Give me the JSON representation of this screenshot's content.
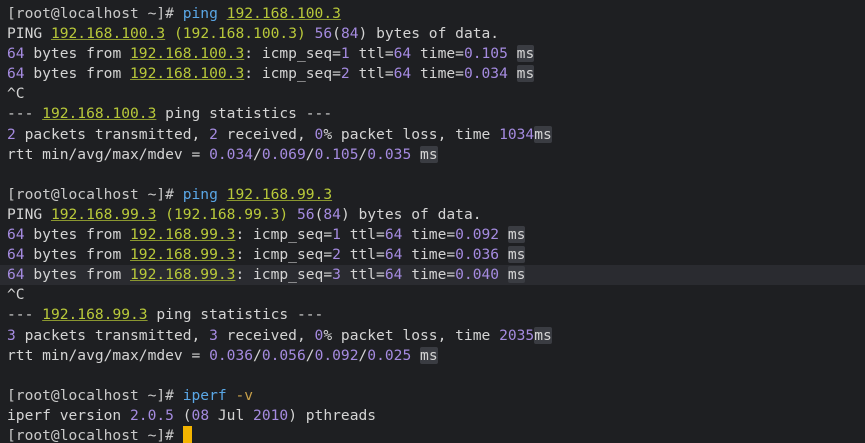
{
  "colors": {
    "background": "#1e1f22",
    "text": "#d4d4d4",
    "command": "#5aa7e6",
    "ip": "#b9c93a",
    "number": "#a58be0",
    "cursor": "#f4b400"
  },
  "lines": [
    {
      "segs": [
        [
          "prompt",
          "[root@localhost ~]# "
        ],
        [
          "cmd",
          "ping "
        ],
        [
          "ip",
          "192.168.100.3"
        ]
      ]
    },
    {
      "segs": [
        [
          "text",
          "PING "
        ],
        [
          "ip",
          "192.168.100.3"
        ],
        [
          "text",
          " "
        ],
        [
          "paren",
          "(192.168.100.3)"
        ],
        [
          "text",
          " "
        ],
        [
          "num",
          "56"
        ],
        [
          "text",
          "("
        ],
        [
          "num",
          "84"
        ],
        [
          "text",
          ") bytes of data."
        ]
      ]
    },
    {
      "segs": [
        [
          "num",
          "64"
        ],
        [
          "text",
          " bytes from "
        ],
        [
          "ip",
          "192.168.100.3"
        ],
        [
          "text",
          ": icmp_seq="
        ],
        [
          "num",
          "1"
        ],
        [
          "text",
          " ttl="
        ],
        [
          "num",
          "64"
        ],
        [
          "text",
          " time="
        ],
        [
          "num",
          "0.105"
        ],
        [
          "text",
          " "
        ],
        [
          "unit",
          "ms"
        ]
      ]
    },
    {
      "segs": [
        [
          "num",
          "64"
        ],
        [
          "text",
          " bytes from "
        ],
        [
          "ip",
          "192.168.100.3"
        ],
        [
          "text",
          ": icmp_seq="
        ],
        [
          "num",
          "2"
        ],
        [
          "text",
          " ttl="
        ],
        [
          "num",
          "64"
        ],
        [
          "text",
          " time="
        ],
        [
          "num",
          "0.034"
        ],
        [
          "text",
          " "
        ],
        [
          "unit",
          "ms"
        ]
      ]
    },
    {
      "segs": [
        [
          "text",
          "^C"
        ]
      ]
    },
    {
      "segs": [
        [
          "text",
          "--- "
        ],
        [
          "ip",
          "192.168.100.3"
        ],
        [
          "text",
          " ping statistics ---"
        ]
      ]
    },
    {
      "segs": [
        [
          "num",
          "2"
        ],
        [
          "text",
          " packets transmitted, "
        ],
        [
          "num",
          "2"
        ],
        [
          "text",
          " received, "
        ],
        [
          "num",
          "0"
        ],
        [
          "text",
          "% packet loss, time "
        ],
        [
          "num",
          "1034"
        ],
        [
          "unit",
          "ms"
        ]
      ]
    },
    {
      "segs": [
        [
          "text",
          "rtt min/avg/max/mdev = "
        ],
        [
          "num",
          "0.034"
        ],
        [
          "text",
          "/"
        ],
        [
          "num",
          "0.069"
        ],
        [
          "text",
          "/"
        ],
        [
          "num",
          "0.105"
        ],
        [
          "text",
          "/"
        ],
        [
          "num",
          "0.035"
        ],
        [
          "text",
          " "
        ],
        [
          "unit",
          "ms"
        ]
      ]
    },
    {
      "segs": [
        [
          "text",
          ""
        ]
      ]
    },
    {
      "segs": [
        [
          "prompt",
          "[root@localhost ~]# "
        ],
        [
          "cmd",
          "ping "
        ],
        [
          "ip",
          "192.168.99.3"
        ]
      ]
    },
    {
      "segs": [
        [
          "text",
          "PING "
        ],
        [
          "ip",
          "192.168.99.3"
        ],
        [
          "text",
          " "
        ],
        [
          "paren",
          "(192.168.99.3)"
        ],
        [
          "text",
          " "
        ],
        [
          "num",
          "56"
        ],
        [
          "text",
          "("
        ],
        [
          "num",
          "84"
        ],
        [
          "text",
          ") bytes of data."
        ]
      ]
    },
    {
      "segs": [
        [
          "num",
          "64"
        ],
        [
          "text",
          " bytes from "
        ],
        [
          "ip",
          "192.168.99.3"
        ],
        [
          "text",
          ": icmp_seq="
        ],
        [
          "num",
          "1"
        ],
        [
          "text",
          " ttl="
        ],
        [
          "num",
          "64"
        ],
        [
          "text",
          " time="
        ],
        [
          "num",
          "0.092"
        ],
        [
          "text",
          " "
        ],
        [
          "unit",
          "ms"
        ]
      ]
    },
    {
      "segs": [
        [
          "num",
          "64"
        ],
        [
          "text",
          " bytes from "
        ],
        [
          "ip",
          "192.168.99.3"
        ],
        [
          "text",
          ": icmp_seq="
        ],
        [
          "num",
          "2"
        ],
        [
          "text",
          " ttl="
        ],
        [
          "num",
          "64"
        ],
        [
          "text",
          " time="
        ],
        [
          "num",
          "0.036"
        ],
        [
          "text",
          " "
        ],
        [
          "unit",
          "ms"
        ]
      ]
    },
    {
      "segs": [
        [
          "num",
          "64"
        ],
        [
          "text",
          " bytes from "
        ],
        [
          "ip",
          "192.168.99.3"
        ],
        [
          "text",
          ": icmp_seq="
        ],
        [
          "num",
          "3"
        ],
        [
          "text",
          " ttl="
        ],
        [
          "num",
          "64"
        ],
        [
          "text",
          " time="
        ],
        [
          "num",
          "0.040"
        ],
        [
          "text",
          " "
        ],
        [
          "unit",
          "ms"
        ]
      ],
      "highlight": true
    },
    {
      "segs": [
        [
          "text",
          "^C"
        ]
      ]
    },
    {
      "segs": [
        [
          "text",
          "--- "
        ],
        [
          "ip",
          "192.168.99.3"
        ],
        [
          "text",
          " ping statistics ---"
        ]
      ]
    },
    {
      "segs": [
        [
          "num",
          "3"
        ],
        [
          "text",
          " packets transmitted, "
        ],
        [
          "num",
          "3"
        ],
        [
          "text",
          " received, "
        ],
        [
          "num",
          "0"
        ],
        [
          "text",
          "% packet loss, time "
        ],
        [
          "num",
          "2035"
        ],
        [
          "unit",
          "ms"
        ]
      ]
    },
    {
      "segs": [
        [
          "text",
          "rtt min/avg/max/mdev = "
        ],
        [
          "num",
          "0.036"
        ],
        [
          "text",
          "/"
        ],
        [
          "num",
          "0.056"
        ],
        [
          "text",
          "/"
        ],
        [
          "num",
          "0.092"
        ],
        [
          "text",
          "/"
        ],
        [
          "num",
          "0.025"
        ],
        [
          "text",
          " "
        ],
        [
          "unit",
          "ms"
        ]
      ]
    },
    {
      "segs": [
        [
          "text",
          ""
        ]
      ]
    },
    {
      "segs": [
        [
          "prompt",
          "[root@localhost ~]# "
        ],
        [
          "cmd",
          "iperf "
        ],
        [
          "flag",
          "-v"
        ]
      ]
    },
    {
      "segs": [
        [
          "text",
          "iperf version "
        ],
        [
          "num",
          "2.0.5"
        ],
        [
          "text",
          " ("
        ],
        [
          "num",
          "08"
        ],
        [
          "text",
          " Jul "
        ],
        [
          "num",
          "2010"
        ],
        [
          "text",
          ") pthreads"
        ]
      ]
    },
    {
      "segs": [
        [
          "prompt",
          "[root@localhost ~]# "
        ]
      ],
      "cursor": true
    }
  ]
}
